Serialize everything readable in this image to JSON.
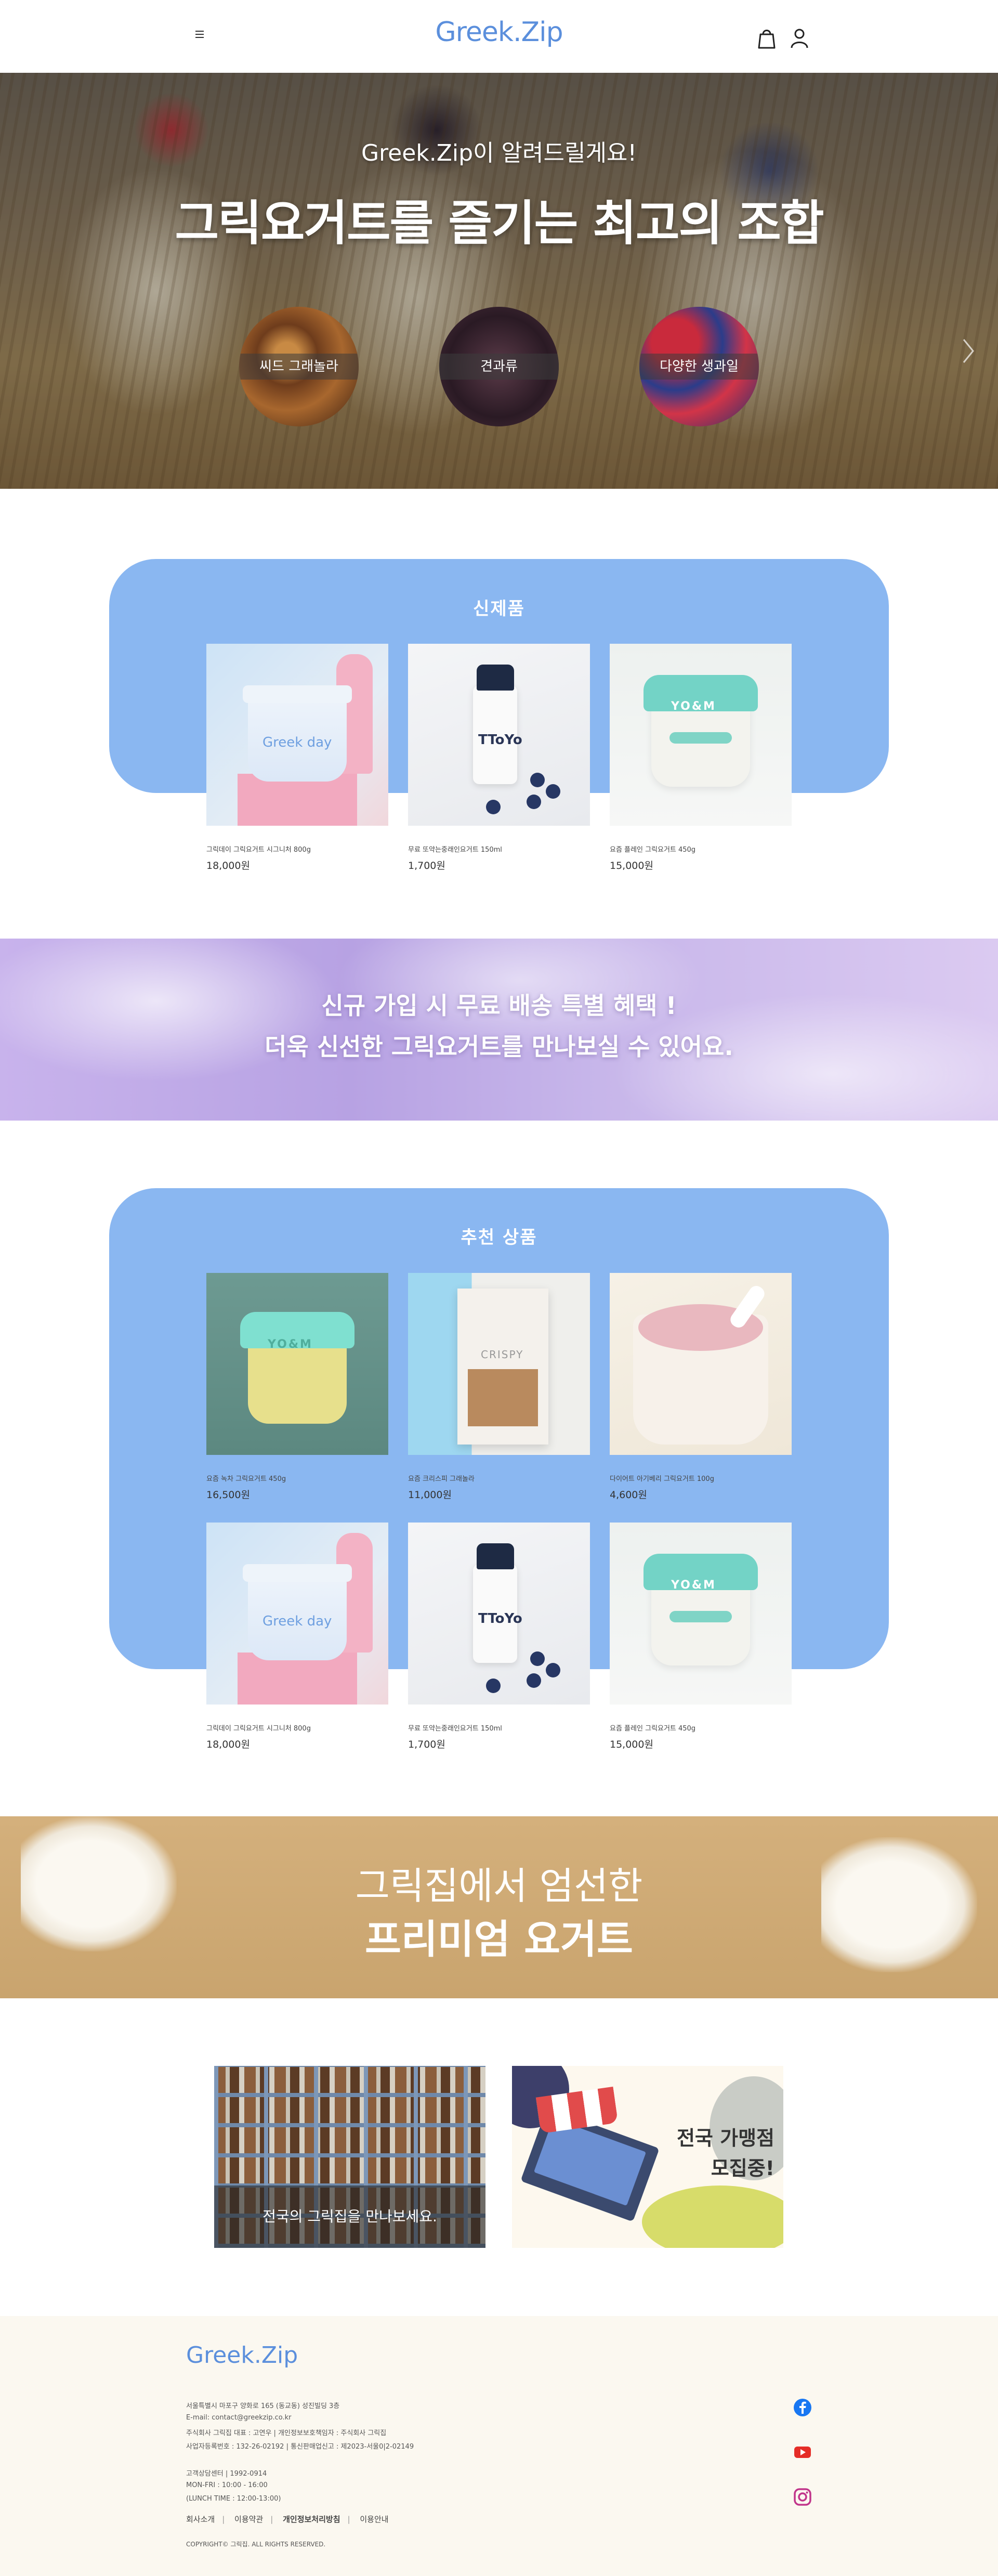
{
  "header": {
    "logo": "Greek.Zip"
  },
  "hero": {
    "subtitle": "Greek.Zip이 알려드릴게요!",
    "title": "그릭요거트를 즐기는 최고의 조합",
    "circles": [
      {
        "label": "씨드 그래놀라"
      },
      {
        "label": "견과류"
      },
      {
        "label": "다양한 생과일"
      }
    ]
  },
  "new_products": {
    "title": "신제품",
    "items": [
      {
        "name": "그릭데이 그릭요거트 시그니처 800g",
        "price": "18,000원"
      },
      {
        "name": "무료 또약는중래인요거트 150ml",
        "price": "1,700원"
      },
      {
        "name": "요즘 플레인 그릭요거트 450g",
        "price": "15,000원"
      }
    ]
  },
  "promo": {
    "line1": "신규 가입 시 무료 배송 특별 혜택 !",
    "line2": "더욱 신선한 그릭요거트를 만나보실 수 있어요."
  },
  "recommended": {
    "title": "추천 상품",
    "items": [
      {
        "name": "요즘 녹차 그릭요거트 450g",
        "price": "16,500원"
      },
      {
        "name": "요즘 크리스피 그래놀라",
        "price": "11,000원"
      },
      {
        "name": "다이어트 아기베리 그릭요거트 100g",
        "price": "4,600원"
      },
      {
        "name": "그릭데이 그릭요거트 시그니처 800g",
        "price": "18,000원"
      },
      {
        "name": "무료 또약는중래인요거트 150ml",
        "price": "1,700원"
      },
      {
        "name": "요즘 플레인 그릭요거트 450g",
        "price": "15,000원"
      }
    ]
  },
  "premium": {
    "line1": "그릭집에서 엄선한",
    "line2": "프리미엄 요거트"
  },
  "stores": {
    "store_caption": "전국의 그릭집을 만나보세요.",
    "franchise_line1": "전국 가맹점",
    "franchise_line2": "모집중!"
  },
  "footer": {
    "logo": "Greek.Zip",
    "info": [
      "서울특별시 마포구 양화로 165 (동교동) 성진빌딩 3층",
      "E-mail: contact@greekzip.co.kr",
      "주식회사 그릭집 대표 : 고연우 | 개인정보보호책임자 : 주식회사 그릭집",
      "사업자등록번호 : 132-26-02192 | 통신판매업신고 : 제2023-서울0|2-02149",
      "",
      "고객상담센터 | 1992-0914",
      "MON-FRI : 10:00 - 16:00",
      "(LUNCH TIME : 12:00-13:00)"
    ],
    "links": [
      "회사소개",
      "이용약관",
      "개인정보처리방침",
      "이용안내"
    ],
    "copyright": "COPYRIGHT© 그릭집. ALL RIGHTS RESERVED.",
    "social_icons": [
      "facebook-icon",
      "youtube-icon",
      "instagram-icon"
    ],
    "colors": {
      "facebook": "#1877f2",
      "youtube": "#e52d27",
      "instagram": "#c1358b"
    }
  },
  "colors": {
    "brand": "#5b8fdc",
    "panel": "#8ab7f1",
    "premium": "#cfa973"
  }
}
